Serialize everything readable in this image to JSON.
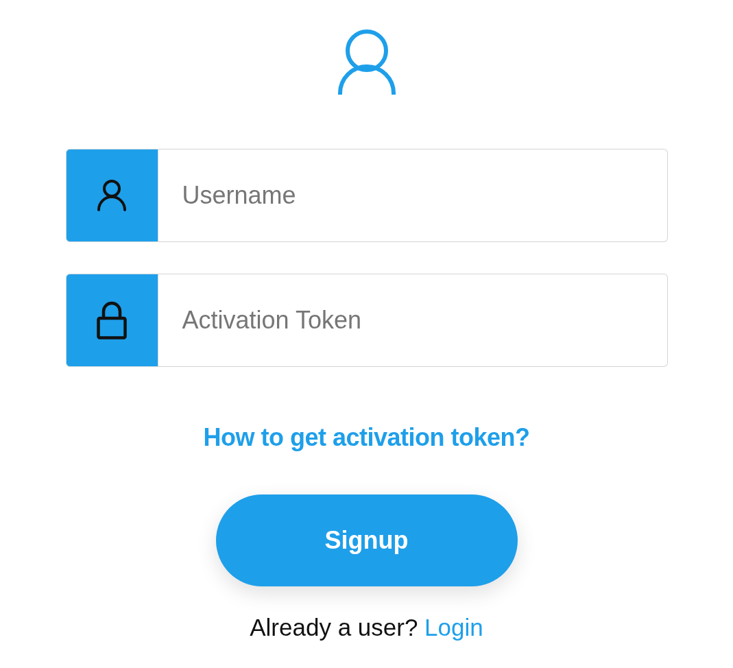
{
  "form": {
    "fields": [
      {
        "kind": "user",
        "placeholder": "Username"
      },
      {
        "kind": "lock",
        "placeholder": "Activation Token"
      }
    ],
    "help_link": "How to get activation token?",
    "submit_button": "Signup",
    "footer": {
      "text": "Already a user?",
      "link": "Login"
    }
  }
}
